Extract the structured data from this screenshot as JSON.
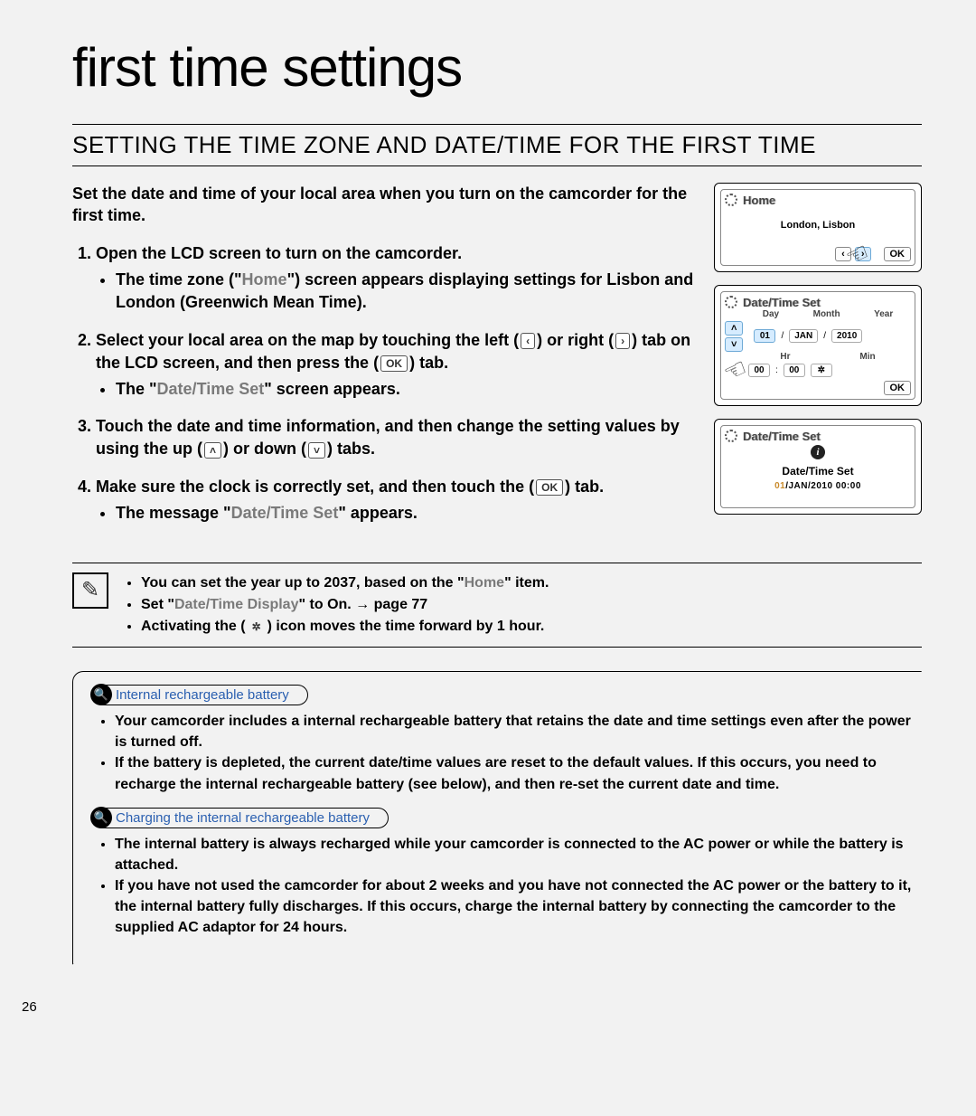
{
  "page": {
    "title": "first time settings",
    "heading": "SETTING THE TIME ZONE AND DATE/TIME FOR THE FIRST TIME",
    "number": "26"
  },
  "intro": "Set the date and time of your local area when you turn on the camcorder for the first time.",
  "steps": {
    "s1": "Open the LCD screen to turn on the camcorder.",
    "s1_a_pre": "The time zone (\"",
    "s1_a_grey": "Home",
    "s1_a_post": "\") screen appears displaying settings for Lisbon and London (Greenwich Mean Time).",
    "s2_a": "Select your local area on the map by touching the left (",
    "s2_b": ") or right (",
    "s2_c": ") tab on the LCD screen, and then press the (",
    "s2_d": ") tab.",
    "s2_bullet_pre": "The \"",
    "s2_bullet_grey": "Date/Time Set",
    "s2_bullet_post": "\" screen appears.",
    "s3_a": "Touch the date and time information, and then change the setting values by using the up (",
    "s3_b": ") or down (",
    "s3_c": ") tabs.",
    "s4_a": "Make sure the clock is correctly set, and then touch the (",
    "s4_b": ") tab.",
    "s4_bullet_pre": "The message \"",
    "s4_bullet_grey": "Date/Time Set",
    "s4_bullet_post": "\" appears."
  },
  "icons": {
    "left": "‹",
    "right": "›",
    "ok": "OK",
    "up": "˄",
    "down": "˅",
    "dst_gear": "✲"
  },
  "notes": {
    "n1_pre": "You can set the year up to 2037, based on the \"",
    "n1_grey": "Home",
    "n1_post": "\" item.",
    "n2_pre": "Set \"",
    "n2_grey": "Date/Time Display",
    "n2_post": "\" to On.  ",
    "n2_ref": "→ page 77",
    "n3_pre": "Activating the (",
    "n3_post": ") icon moves the time forward by 1 hour."
  },
  "callout": {
    "pill1": "Internal rechargeable battery",
    "b1": "Your camcorder includes a internal rechargeable battery that retains the date and time settings even after the power is turned off.",
    "b2": "If the battery is depleted, the current date/time values are reset to the default values. If this occurs, you need to recharge the internal rechargeable battery (see below), and then re-set the current date and time.",
    "pill2": "Charging the internal rechargeable battery",
    "b3": "The internal battery is always recharged while your camcorder is connected to the AC power or while the battery is attached.",
    "b4": "If you have not used the camcorder for about 2 weeks and you have not connected the AC power or the battery to it, the internal battery fully discharges. If this occurs, charge the internal battery by connecting the camcorder to the supplied AC adaptor for 24 hours."
  },
  "lcd1": {
    "title": "Home",
    "location": "London, Lisbon",
    "left": "‹",
    "right": "›",
    "ok": "OK"
  },
  "lcd2": {
    "title": "Date/Time Set",
    "labels": {
      "day": "Day",
      "month": "Month",
      "year": "Year",
      "hr": "Hr",
      "min": "Min"
    },
    "day": "01",
    "month": "JAN",
    "year": "2010",
    "hr": "00",
    "min": "00",
    "ok": "OK"
  },
  "lcd3": {
    "title": "Date/Time Set",
    "msg": "Date/Time Set",
    "value_pre": "01",
    "value_mid": "/JAN/2010 00:00"
  }
}
